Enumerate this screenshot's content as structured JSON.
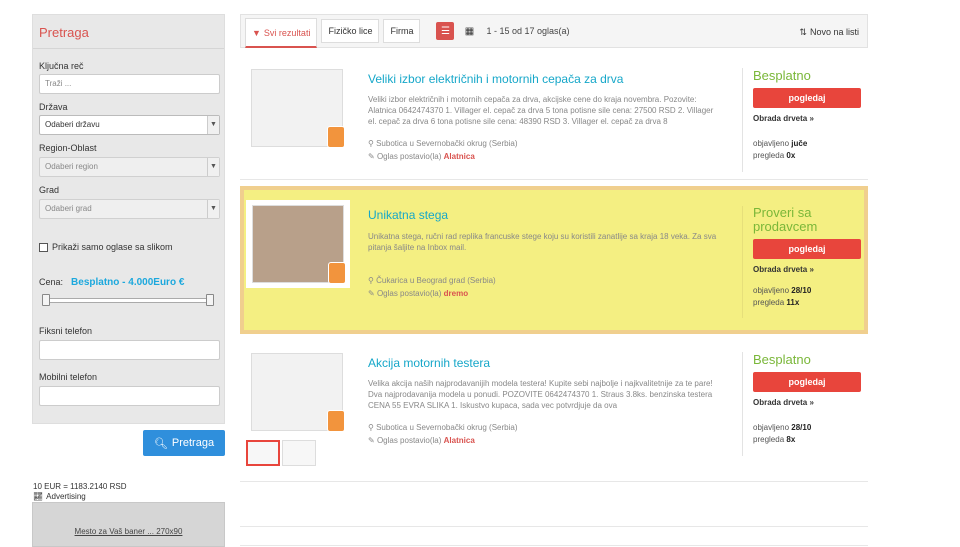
{
  "sidebar": {
    "title": "Pretraga",
    "keyword_label": "Ključna reč",
    "keyword_placeholder": "Traži ...",
    "country_label": "Država",
    "country_value": "Odaberi državu",
    "region_label": "Region-Oblast",
    "region_value": "Odaberi region",
    "city_label": "Grad",
    "city_value": "Odaberi grad",
    "photos_only_label": "Prikaži samo oglase sa slikom",
    "price_label": "Cena:",
    "price_range": "Besplatno - 4.000Euro €",
    "price_range_fraction": [
      0,
      1
    ],
    "fixed_phone_label": "Fiksni telefon",
    "mobile_phone_label": "Mobilni telefon",
    "search_button": "Pretraga",
    "exchange_rate": "10 EUR = 1183.2140 RSD",
    "advertising_label": "Advertising",
    "banner_text": "Mesto za Vaš baner ... 270x90"
  },
  "toolbar": {
    "tabs": [
      "Svi rezultati",
      "Fizičko lice",
      "Firma"
    ],
    "count": "1 - 15 od 17 oglas(a)",
    "sort_label": "Novo na listi"
  },
  "listings": [
    {
      "title": "Veliki izbor električnih i motornih cepača za drva",
      "description": "Veliki izbor električnih i motornih cepača za drva, akcijske cene do kraja novembra. Pozovite: Alatnica 0642474370 1. Villager el. cepač za drva 5 tona potisne sile cena: 27500 RSD 2. Villager el. cepač za drva 6 tona potisne sile cena: 48390 RSD 3. Villager el. cepač za drva 8",
      "location": "Subotica u Severnobački okrug (Serbia)",
      "posted_by_label": "Oglas postavio(la)",
      "posted_by": "Alatnica",
      "price": "Besplatno",
      "button": "pogledaj",
      "category": "Obrada drveta",
      "published_label": "objavljeno",
      "published": "juče",
      "views_label": "pregleda",
      "views": "0x"
    },
    {
      "title": "Unikatna stega",
      "description": "Unikatna stega, ručni rad replika francuske stege koju su koristili zanatlije sa kraja 18 veka. Za sva pitanja šaljite na Inbox mail.",
      "location": "Čukarica u Beograd grad (Serbia)",
      "posted_by_label": "Oglas postavio(la)",
      "posted_by": "dremo",
      "price": "Proveri sa prodavcem",
      "button": "pogledaj",
      "category": "Obrada drveta",
      "published_label": "objavljeno",
      "published": "28/10",
      "views_label": "pregleda",
      "views": "11x"
    },
    {
      "title": "Akcija motornih testera",
      "description": "Velika akcija naših najprodavanijih modela testera! Kupite sebi najbolje i najkvalitetnije za te pare! Dva najprodavanija modela u ponudi. POZOVITE 0642474370 1. Straus 3.8ks. benzinska testera CENA 55 EVRA SLIKA 1. Iskustvo kupaca, sada vec potvrdjuje da ova",
      "location": "Subotica u Severnobački okrug (Serbia)",
      "posted_by_label": "Oglas postavio(la)",
      "posted_by": "Alatnica",
      "price": "Besplatno",
      "button": "pogledaj",
      "category": "Obrada drveta",
      "published_label": "objavljeno",
      "published": "28/10",
      "views_label": "pregleda",
      "views": "8x"
    }
  ],
  "colors": {
    "accent": "#d9534f",
    "link": "#16a7c9",
    "price": "#7ab739",
    "highlight": "#f4ef82"
  }
}
